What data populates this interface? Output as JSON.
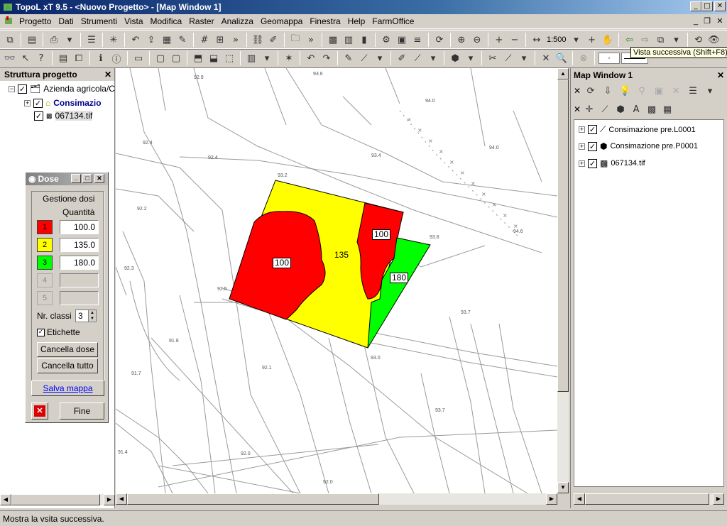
{
  "window": {
    "title": "TopoL xT 9.5 - <Nuovo Progetto> - [Map Window 1]",
    "btn_min": "_",
    "btn_max": "□",
    "btn_close": "✕"
  },
  "menu": [
    "Progetto",
    "Dati",
    "Strumenti",
    "Vista",
    "Modifica",
    "Raster",
    "Analizza",
    "Geomappa",
    "Finestra",
    "Help",
    "FarmOffice"
  ],
  "toolbar": {
    "scale": "1:500",
    "tooltip": "Vista successiva (Shift+F8)"
  },
  "project": {
    "title": "Struttura progetto",
    "root": "Azienda agricola/C",
    "layer1": "Consimazio",
    "layer2": "067134.tif"
  },
  "dose": {
    "title": "Dose",
    "group": "Gestione dosi",
    "qty_label": "Quantità",
    "classes": [
      {
        "num": "1",
        "value": "100.0",
        "color": "#ff0000"
      },
      {
        "num": "2",
        "value": "135.0",
        "color": "#ffff00"
      },
      {
        "num": "3",
        "value": "180.0",
        "color": "#00ff00"
      },
      {
        "num": "4",
        "value": ""
      },
      {
        "num": "5",
        "value": ""
      }
    ],
    "nr_classi_label": "Nr. classi",
    "nr_classi": "3",
    "etichette": "Etichette",
    "cancel_dose": "Cancella dose",
    "cancel_all": "Cancella tutto",
    "save_map": "Salva mappa",
    "finish": "Fine"
  },
  "map": {
    "labels": {
      "red_left": "100",
      "yellow": "135",
      "red_right": "100",
      "green": "180"
    },
    "spot_heights": [
      "92.9",
      "93.6",
      "94.0",
      "92.4",
      "93.4",
      "94.0",
      "93.2",
      "92.4",
      "92.2",
      "94.6",
      "93.8",
      "92.3",
      "92.5",
      "93.7",
      "91.8",
      "92.1",
      "93.0",
      "91.7",
      "93.7",
      "91.4",
      "92.0",
      "92.0"
    ]
  },
  "map_window": {
    "title": "Map Window 1",
    "layers": [
      "Consimazione pre.L0001",
      "Consimazione pre.P0001",
      "067134.tif"
    ]
  },
  "status": "Mostra la vsita successiva."
}
